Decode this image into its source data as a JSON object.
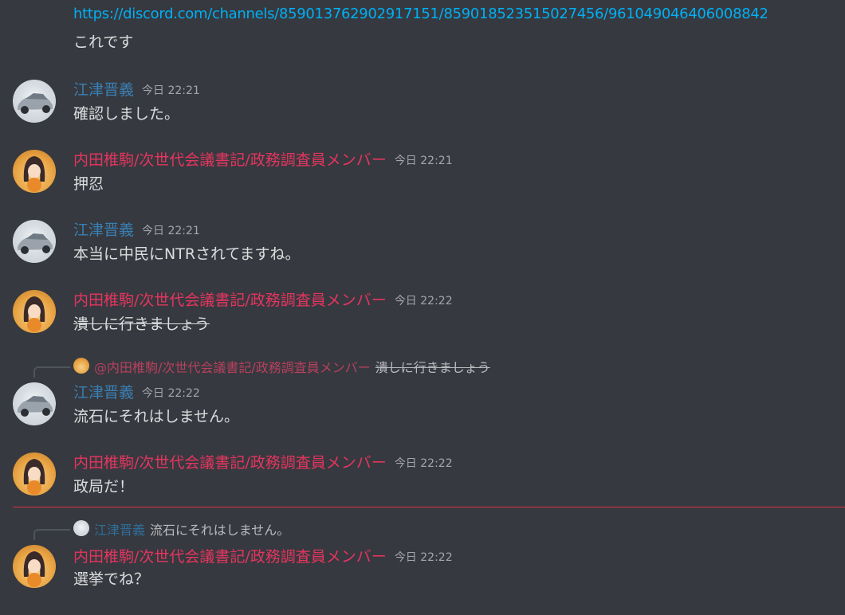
{
  "top": {
    "link": "https://discord.com/channels/859013762902917151/859018523515027456/961049046406008842",
    "continuation": "これです"
  },
  "users": {
    "etsu": "江津晋義",
    "uchida": "内田椎駒/次世代会議書記/政務調査員メンバー"
  },
  "messages": [
    {
      "author": "江津晋義",
      "time": "今日 22:21",
      "text": "確認しました。"
    },
    {
      "author": "内田椎駒/次世代会議書記/政務調査員メンバー",
      "time": "今日 22:21",
      "text": "押忍"
    },
    {
      "author": "江津晋義",
      "time": "今日 22:21",
      "text": "本当に中民にNTRされてますね。"
    },
    {
      "author": "内田椎駒/次世代会議書記/政務調査員メンバー",
      "time": "今日 22:22",
      "text": "潰しに行きましょう"
    },
    {
      "author": "江津晋義",
      "time": "今日 22:22",
      "text": "流石にそれはしません。",
      "reply": {
        "name": "@内田椎駒/次世代会議書記/政務調査員メンバー",
        "text": "潰しに行きましょう"
      }
    },
    {
      "author": "内田椎駒/次世代会議書記/政務調査員メンバー",
      "time": "今日 22:22",
      "text": "政局だ！"
    },
    {
      "author": "内田椎駒/次世代会議書記/政務調査員メンバー",
      "time": "今日 22:22",
      "text": "選挙でね？",
      "reply": {
        "name": "江津晋義",
        "text": "流石にそれはしません。"
      }
    }
  ],
  "colors": {
    "background": "#36393f",
    "link": "#00b0f4",
    "name_blue": "#3a7fb3",
    "name_red": "#e5355f",
    "new_messages_line": "#d9323f"
  },
  "icons": {
    "car_avatar": "car-avatar",
    "anime_avatar": "anime-girl-avatar"
  }
}
